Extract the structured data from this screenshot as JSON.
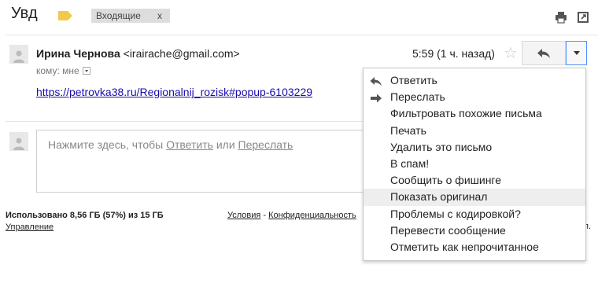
{
  "header": {
    "subject": "Увд",
    "inbox_chip": "Входящие",
    "inbox_chip_close": "x",
    "icons": [
      "label-tag-icon",
      "print-icon",
      "open-new-window-icon"
    ],
    "label_color": "#f2c94c"
  },
  "message": {
    "sender_name": "Ирина Чернова",
    "sender_email": "<irairache@gmail.com>",
    "to_line": "кому: мне",
    "time": "5:59 (1 ч. назад)",
    "link_text": "https://petrovka38.ru/Regionalnij_rozisk#popup-6103229"
  },
  "reply_box": {
    "prefix": "Нажмите здесь, чтобы ",
    "reply_link": "Ответить",
    "or": " или ",
    "forward_link": "Переслать"
  },
  "footer": {
    "storage": "Использовано 8,56 ГБ (57%) из 15 ГБ",
    "manage": "Управление",
    "terms": "Условия",
    "separator": " - ",
    "privacy": "Конфиденциальность",
    "right_fragment": "п."
  },
  "menu": {
    "items": [
      {
        "label": "Ответить",
        "icon": "reply-icon"
      },
      {
        "label": "Переслать",
        "icon": "forward-icon"
      },
      {
        "label": "Фильтровать похожие письма"
      },
      {
        "label": "Печать"
      },
      {
        "label": "Удалить это письмо"
      },
      {
        "label": "В спам!"
      },
      {
        "label": "Сообщить о фишинге"
      },
      {
        "label": "Показать оригинал",
        "highlighted": true
      },
      {
        "label": "Проблемы с кодировкой?"
      },
      {
        "label": "Перевести сообщение"
      },
      {
        "label": "Отметить как непрочитанное"
      }
    ]
  },
  "colors": {
    "link": "#1a0dab",
    "dropdown_border": "#4d90fe",
    "menu_hover": "#eeeeee"
  }
}
